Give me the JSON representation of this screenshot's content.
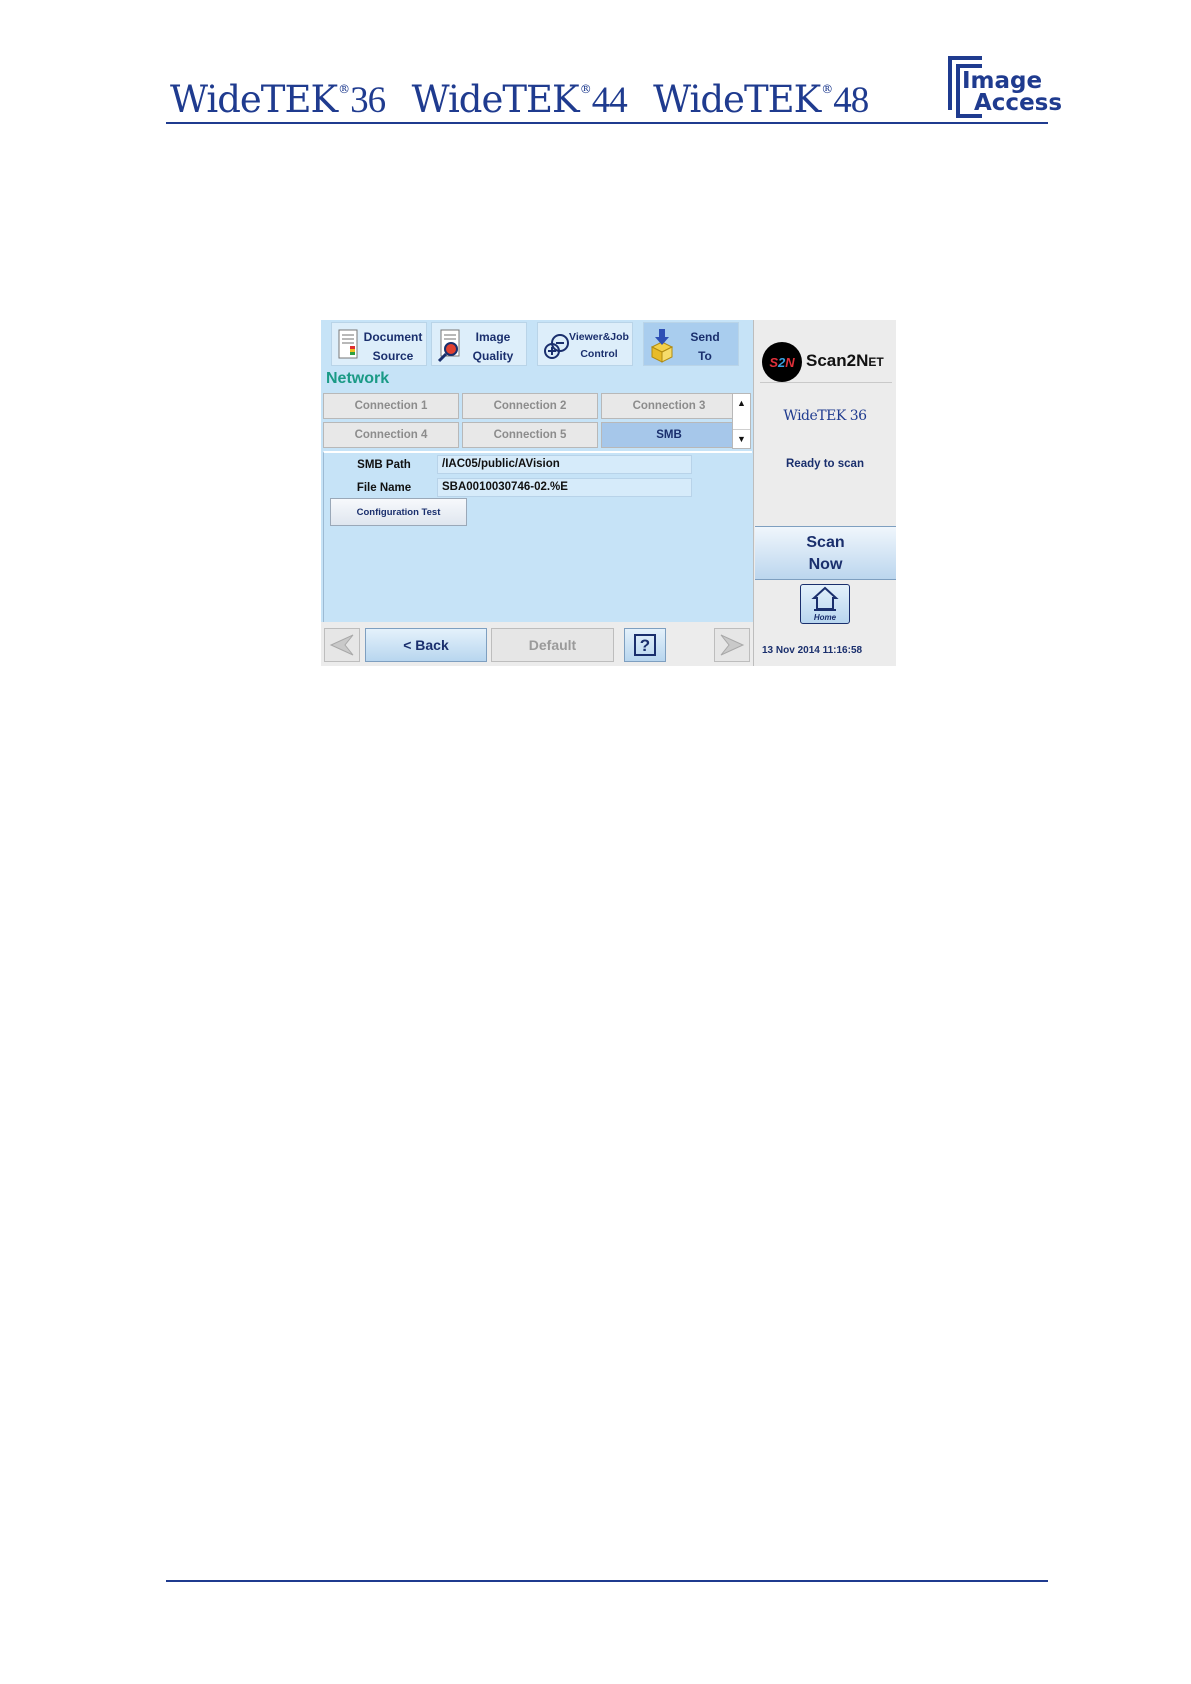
{
  "header": {
    "brands": [
      {
        "name": "WideTEK",
        "reg": "®",
        "model": "36"
      },
      {
        "name": "WideTEK",
        "reg": "®",
        "model": "44"
      },
      {
        "name": "WideTEK",
        "reg": "®",
        "model": "48"
      }
    ],
    "logo": {
      "line1": "Image",
      "line2": "Access"
    }
  },
  "toolbar": [
    {
      "line1": "Document",
      "line2": "Source",
      "icon": "document-source-icon"
    },
    {
      "line1": "Image",
      "line2": "Quality",
      "icon": "image-quality-icon"
    },
    {
      "line1": "Viewer&Job",
      "line2": "Control",
      "icon": "viewer-zoom-icon"
    },
    {
      "line1": "Send",
      "line2": "To",
      "icon": "send-to-icon",
      "active": true
    }
  ],
  "section_title": "Network",
  "tabs": [
    {
      "label": "Connection 1"
    },
    {
      "label": "Connection 2"
    },
    {
      "label": "Connection 3"
    },
    {
      "label": "Connection 4"
    },
    {
      "label": "Connection 5"
    },
    {
      "label": "SMB",
      "active": true
    }
  ],
  "form": {
    "smb_path_label": "SMB Path",
    "smb_path_value": "/IAC05/public/AVision",
    "file_name_label": "File Name",
    "file_name_value": "SBA0010030746-02.%E",
    "config_test_label": "Configuration Test"
  },
  "bottom": {
    "back_label": "< Back",
    "default_label": "Default",
    "help_label": "?"
  },
  "side": {
    "s2n_mark": {
      "a": "S",
      "b": "2",
      "c": "N"
    },
    "product_text": {
      "p1": "Scan",
      "p2": "2",
      "p3": "N",
      "p4": "ET"
    },
    "model_name": "WideTEK 36",
    "status": "Ready to scan",
    "scan_line1": "Scan",
    "scan_line2": "Now",
    "home_label": "Home",
    "datetime": "13 Nov 2014 11:16:58"
  },
  "colors": {
    "brand_blue": "#1f3b8f",
    "panel_blue": "#c6e3f7",
    "accent_teal": "#1a9a86",
    "active_tab": "#a6c7ea"
  }
}
